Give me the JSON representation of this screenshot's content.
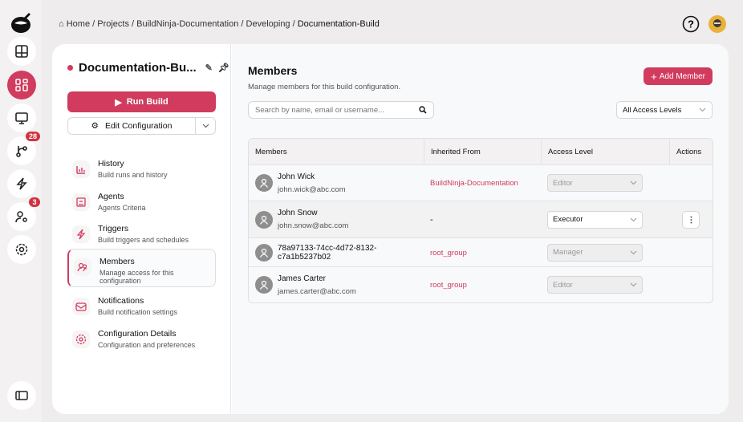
{
  "breadcrumb": [
    "Home",
    "Projects",
    "BuildNinja-Documentation",
    "Developing",
    "Documentation-Build"
  ],
  "rail": {
    "badges": {
      "pipelines": "28",
      "users": "3"
    }
  },
  "config": {
    "title": "Documentation-Bu...",
    "run_label": "Run Build",
    "edit_label": "Edit Configuration"
  },
  "nav": [
    {
      "title": "History",
      "sub": "Build runs and history",
      "icon": "chart-icon"
    },
    {
      "title": "Agents",
      "sub": "Agents Criteria",
      "icon": "agent-icon"
    },
    {
      "title": "Triggers",
      "sub": "Build triggers and schedules",
      "icon": "lightning-icon"
    },
    {
      "title": "Members",
      "sub": "Manage access for this configuration",
      "icon": "users-icon"
    },
    {
      "title": "Notifications",
      "sub": "Build notification settings",
      "icon": "mail-icon"
    },
    {
      "title": "Configuration Details",
      "sub": "Configuration and preferences",
      "icon": "gear-icon"
    }
  ],
  "members": {
    "title": "Members",
    "subtitle": "Manage members for this build configuration.",
    "add_label": "Add Member",
    "search_placeholder": "Search by name, email or username...",
    "filter": "All Access Levels",
    "columns": [
      "Members",
      "Inherited From",
      "Access Level",
      "Actions"
    ],
    "rows": [
      {
        "name": "John Wick",
        "email": "john.wick@abc.com",
        "inherited": "BuildNinja-Documentation",
        "access": "Editor",
        "editable": false
      },
      {
        "name": "John Snow",
        "email": "john.snow@abc.com",
        "inherited": "-",
        "access": "Executor",
        "editable": true
      },
      {
        "name": "78a97133-74cc-4d72-8132-c7a1b5237b02",
        "email": "",
        "inherited": "root_group",
        "access": "Manager",
        "editable": false
      },
      {
        "name": "James Carter",
        "email": "james.carter@abc.com",
        "inherited": "root_group",
        "access": "Editor",
        "editable": false
      }
    ]
  },
  "colors": {
    "accent": "#d13b5e",
    "badge": "#d0343f"
  }
}
